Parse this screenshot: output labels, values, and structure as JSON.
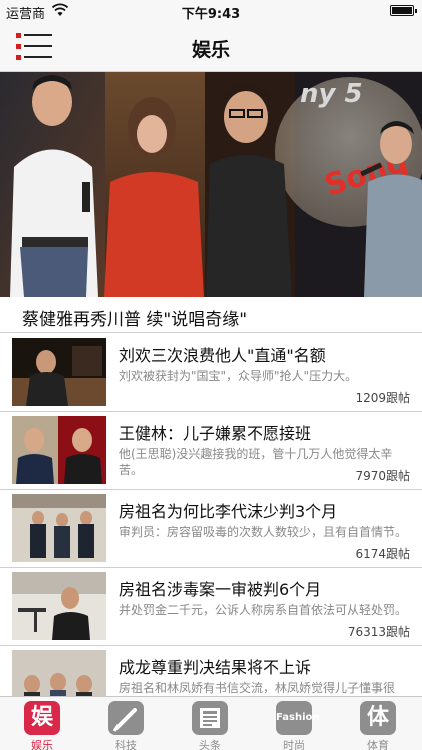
{
  "status_bar": {
    "carrier": "运营商",
    "time": "下午9:43"
  },
  "nav": {
    "title": "娱乐",
    "menu_icon": "menu-icon"
  },
  "hero": {
    "caption": "蔡健雅再秀川普 续\"说唱奇缘\""
  },
  "news": [
    {
      "headline": "刘欢三次浪费他人\"直通\"名额",
      "summary": "刘欢被获封为\"国宝\"，众导师\"抢人\"压力大。",
      "comments": "1209跟帖"
    },
    {
      "headline": "王健林：儿子嫌累不愿接班",
      "summary": "他(王思聪)没兴趣接我的班，管十几万人他觉得太辛苦。",
      "comments": "7970跟帖"
    },
    {
      "headline": "房祖名为何比李代沫少判3个月",
      "summary": "审判员：房容留吸毒的次数人数较少，且有自首情节。",
      "comments": "6174跟帖"
    },
    {
      "headline": "房祖名涉毒案一审被判6个月",
      "summary": "并处罚金二千元，公诉人称房系自首依法可从轻处罚。",
      "comments": "76313跟帖"
    },
    {
      "headline": "成龙尊重判决结果将不上诉",
      "summary": "房祖名和林凤娇有书信交流，林凤娇觉得儿子懂事很",
      "comments": ""
    }
  ],
  "tabs": [
    {
      "label": "娱乐",
      "icon_text": "娱",
      "icon": "entertainment-icon",
      "active": true
    },
    {
      "label": "科技",
      "icon_text": "",
      "icon": "tech-icon",
      "active": false
    },
    {
      "label": "头条",
      "icon_text": "",
      "icon": "headlines-icon",
      "active": false
    },
    {
      "label": "时尚",
      "icon_text": "Fashion",
      "icon": "fashion-icon",
      "active": false
    },
    {
      "label": "体育",
      "icon_text": "体",
      "icon": "sports-icon",
      "active": false
    }
  ],
  "colors": {
    "accent": "#d9284a",
    "menu_dot": "#d71e1e",
    "inactive_tab": "#8e8e8e"
  }
}
